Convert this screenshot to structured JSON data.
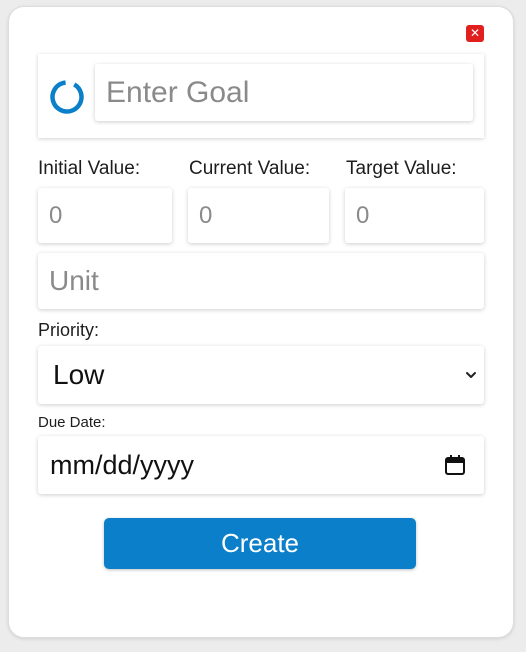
{
  "close_button": {
    "label": "✕"
  },
  "goal": {
    "placeholder": "Enter Goal",
    "value": "",
    "progress_color": "#0b7fc9"
  },
  "values": {
    "initial": {
      "label": "Initial Value:",
      "placeholder": "0"
    },
    "current": {
      "label": "Current Value:",
      "placeholder": "0"
    },
    "target": {
      "label": "Target Value:",
      "placeholder": "0"
    }
  },
  "unit": {
    "placeholder": "Unit"
  },
  "priority": {
    "label": "Priority:",
    "selected": "Low"
  },
  "due_date": {
    "label": "Due Date:",
    "placeholder": "mm/dd/yyyy"
  },
  "create_button": {
    "label": "Create",
    "color": "#0b7fc9"
  }
}
